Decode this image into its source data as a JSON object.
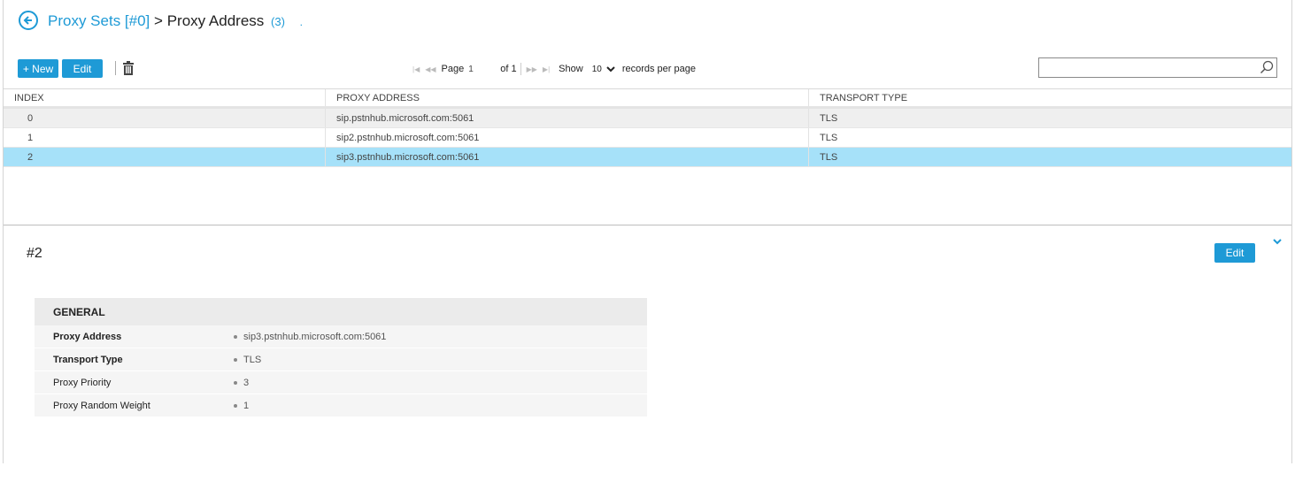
{
  "header": {
    "parent_link": "Proxy Sets [#0]",
    "separator": ">",
    "current": "Proxy Address",
    "count": "(3)",
    "dot": "."
  },
  "toolbar": {
    "new_label": "+ New",
    "edit_label": "Edit"
  },
  "pager": {
    "page_label": "Page",
    "page_value": "1",
    "of_label": "of 1",
    "show_label": "Show",
    "per_page_value": "10",
    "records_label": "records per page"
  },
  "search": {
    "placeholder": "",
    "value": ""
  },
  "table": {
    "columns": [
      "INDEX",
      "PROXY ADDRESS",
      "TRANSPORT TYPE"
    ],
    "rows": [
      {
        "index": "0",
        "address": "sip.pstnhub.microsoft.com:5061",
        "transport": "TLS"
      },
      {
        "index": "1",
        "address": "sip2.pstnhub.microsoft.com:5061",
        "transport": "TLS"
      },
      {
        "index": "2",
        "address": "sip3.pstnhub.microsoft.com:5061",
        "transport": "TLS"
      }
    ],
    "selected_index": 2
  },
  "detail": {
    "title": "#2",
    "edit_label": "Edit",
    "section_title": "GENERAL",
    "fields": [
      {
        "label": "Proxy Address",
        "value": "sip3.pstnhub.microsoft.com:5061"
      },
      {
        "label": "Transport Type",
        "value": "TLS"
      },
      {
        "label": "Proxy Priority",
        "value": "3"
      },
      {
        "label": "Proxy Random Weight",
        "value": "1"
      }
    ]
  },
  "colors": {
    "accent": "#1e9ad6",
    "selected_row": "#a6e1f9",
    "section_header": "#ebebeb"
  },
  "icons": [
    "back-arrow-icon",
    "trash-icon",
    "first-page-icon",
    "prev-page-icon",
    "next-page-icon",
    "last-page-icon",
    "chevron-down-icon",
    "search-icon"
  ]
}
